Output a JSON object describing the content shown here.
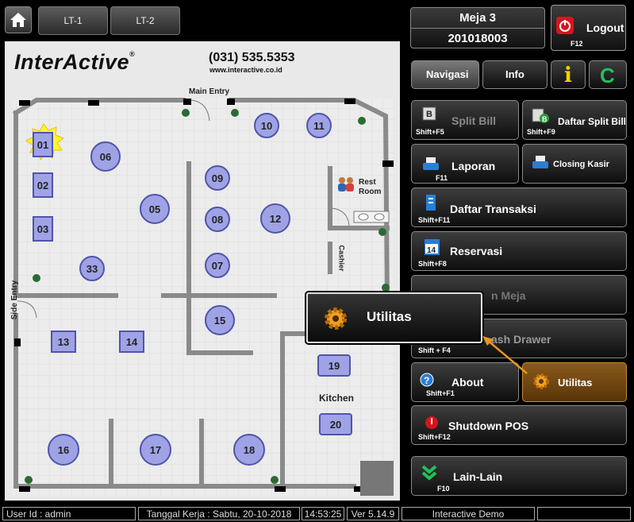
{
  "topbar": {
    "floor_tabs": [
      "LT-1",
      "LT-2"
    ]
  },
  "brand": {
    "name": "InterActive",
    "reg": "®",
    "phone": "(031) 535.5353",
    "website": "www.interactive.co.id"
  },
  "plan": {
    "labels": {
      "main_entry": "Main Entry",
      "side_entry": "Side Entry",
      "rest_room_1": "Rest",
      "rest_room_2": "Room",
      "cashier": "Cashier",
      "kitchen": "Kitchen"
    },
    "tables": [
      "01",
      "02",
      "03",
      "05",
      "06",
      "07",
      "08",
      "09",
      "10",
      "11",
      "12",
      "13",
      "14",
      "15",
      "16",
      "17",
      "18",
      "19",
      "20",
      "33"
    ]
  },
  "session": {
    "table_title": "Meja 3",
    "order_no": "201018003"
  },
  "logout": {
    "label": "Logout",
    "key": "F12"
  },
  "tabs": {
    "navigasi": "Navigasi",
    "info": "Info",
    "i_label": "i",
    "c_label": "C"
  },
  "buttons": {
    "split_bill": {
      "label": "Split Bill",
      "key": "Shift+F5"
    },
    "daftar_split_bill": {
      "label": "Daftar Split Bill",
      "key": "Shift+F9"
    },
    "laporan": {
      "label": "Laporan",
      "key": "F11"
    },
    "closing_kasir": {
      "label": "Closing Kasir",
      "key": ""
    },
    "daftar_transaksi": {
      "label": "Daftar Transaksi",
      "key": "Shift+F11"
    },
    "reservasi": {
      "label": "Reservasi",
      "key": "Shift+F8"
    },
    "pindah_meja": {
      "label": "n Meja"
    },
    "cash_drawer": {
      "label": "ash Drawer",
      "key": "Shift + F4"
    },
    "about": {
      "label": "About",
      "key": "Shift+F1"
    },
    "utilitas": {
      "label": "Utilitas"
    },
    "shutdown": {
      "label": "Shutdown POS",
      "key": "Shift+F12"
    },
    "lain_lain": {
      "label": "Lain-Lain",
      "key": "F10"
    }
  },
  "popup": {
    "label": "Utilitas"
  },
  "status": {
    "user": "User Id : admin",
    "work_date": "Tanggal Kerja : Sabtu, 20-10-2018",
    "time": "14:53:25",
    "version": "Ver 5.14.9",
    "company": "Interactive Demo",
    "extra": ""
  },
  "colors": {
    "accent_orange": "#e8961e",
    "table_fill": "#9fa3e6",
    "info_yellow": "#f2d400",
    "c_green": "#22c05a",
    "logout_red": "#d8141e"
  }
}
